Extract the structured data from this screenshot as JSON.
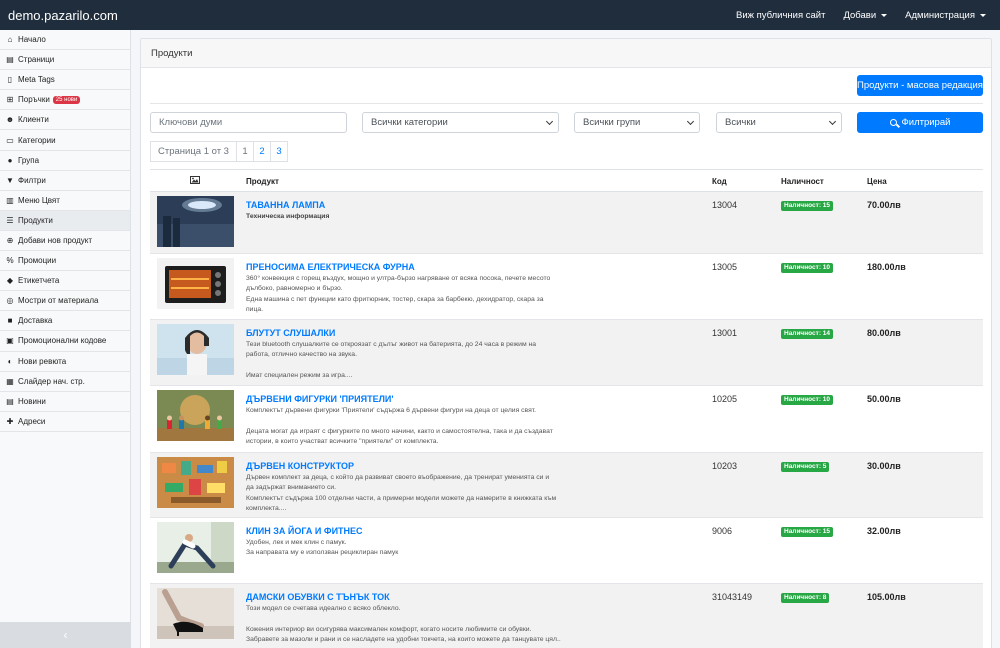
{
  "topbar": {
    "brand": "demo.pazarilo.com",
    "links": [
      {
        "label": "Виж публичния сайт",
        "dropdown": false
      },
      {
        "label": "Добави",
        "dropdown": true
      },
      {
        "label": "Администрация",
        "dropdown": true
      }
    ]
  },
  "sidebar": {
    "items": [
      {
        "label": "Начало",
        "icon": "home-icon",
        "glyph": "⌂"
      },
      {
        "label": "Страници",
        "icon": "page-icon",
        "glyph": "▤"
      },
      {
        "label": "Meta Tags",
        "icon": "file-icon",
        "glyph": "▯"
      },
      {
        "label": "Поръчки",
        "icon": "cart-icon",
        "glyph": "⊞",
        "badge": "25 нови"
      },
      {
        "label": "Клиенти",
        "icon": "users-icon",
        "glyph": "☻"
      },
      {
        "label": "Категории",
        "icon": "folder-icon",
        "glyph": "▭"
      },
      {
        "label": "Група",
        "icon": "group-icon",
        "glyph": "●"
      },
      {
        "label": "Филтри",
        "icon": "filter-icon",
        "glyph": "▼"
      },
      {
        "label": "Меню Цвят",
        "icon": "palette-icon",
        "glyph": "▥"
      },
      {
        "label": "Продукти",
        "icon": "list-icon",
        "glyph": "☰",
        "active": true
      },
      {
        "label": "Добави нов продукт",
        "icon": "plus-circle-icon",
        "glyph": "⊕"
      },
      {
        "label": "Промоции",
        "icon": "percent-icon",
        "glyph": "%"
      },
      {
        "label": "Етикетчета",
        "icon": "tag-icon",
        "glyph": "◆"
      },
      {
        "label": "Мостри от материала",
        "icon": "sample-icon",
        "glyph": "◎"
      },
      {
        "label": "Доставка",
        "icon": "truck-icon",
        "glyph": "■"
      },
      {
        "label": "Промоционални кодове",
        "icon": "ticket-icon",
        "glyph": "▣"
      },
      {
        "label": "Нови ревюта",
        "icon": "comments-icon",
        "glyph": "◐"
      },
      {
        "label": "Слайдер нач. стр.",
        "icon": "slider-icon",
        "glyph": "▦"
      },
      {
        "label": "Новини",
        "icon": "news-icon",
        "glyph": "▤"
      },
      {
        "label": "Адреси",
        "icon": "location-icon",
        "glyph": "✚"
      }
    ],
    "collapse_glyph": "‹"
  },
  "main": {
    "title": "Продукти",
    "bulk_edit_label": "Продукти - масова редакция",
    "keyword_placeholder": "Ключови думи",
    "category_select": "Всички категории",
    "group_select": "Всички групи",
    "status_select": "Всички",
    "filter_label": "Филтрирай",
    "pagination": {
      "info": "Страница 1 от 3",
      "pages": [
        "1",
        "2",
        "3"
      ],
      "current": "1"
    },
    "columns": {
      "image": "image-icon",
      "product": "Продукт",
      "code": "Код",
      "stock": "Наличност",
      "price": "Цена"
    }
  },
  "products": [
    {
      "name": "ТАВАННА ЛАМПА",
      "desc": [
        "Техническа информация"
      ],
      "desc_bold": true,
      "code": "13004",
      "stock": "Наличност: 15",
      "price": "70.00лв",
      "image": "ceiling-lamp-image"
    },
    {
      "name": "ПРЕНОСИМА ЕЛЕКТРИЧЕСКА ФУРНА",
      "desc": [
        "360° конвекция с горещ въздух, мощно и ултра-бързо нагряване от всяка посока, печете месото",
        "дълбоко, равномерно и бързо.",
        "Една машина с пет функции като фритюрник, тостер, скара за барбекю, дехидратор, скара за",
        "пица."
      ],
      "code": "13005",
      "stock": "Наличност: 10",
      "price": "180.00лв",
      "image": "electric-oven-image"
    },
    {
      "name": "БЛУТУТ СЛУШАЛКИ",
      "desc": [
        "Тези bluetooth слушалките се откроязат с дълъг живот на батерията, до 24 часа в режим на",
        "работа, отлично качество на звука.",
        "",
        "Имат специален режим за игра...."
      ],
      "code": "13001",
      "stock": "Наличност: 14",
      "price": "80.00лв",
      "image": "bluetooth-headphones-image"
    },
    {
      "name": "ДЪРВЕНИ ФИГУРКИ 'ПРИЯТЕЛИ'",
      "desc": [
        "Комплектът дървени фигурки 'Приятели' съдържа 6 дървени фигури на деца от целия свят.",
        "",
        "Децата могат да играят с фигурките по много начини, както и самостоятелна, така и да създават",
        "истории, в които участват всичките \"приятели\" от комплекта."
      ],
      "code": "10205",
      "stock": "Наличност: 10",
      "price": "50.00лв",
      "image": "wooden-figures-image"
    },
    {
      "name": "ДЪРВЕН КОНСТРУКТОР",
      "desc": [
        "Дървен комплект за деца, с който да развиват своето въображение, да тренират уменията си и",
        "да задържат вниманието си.",
        "Комплектът съдържа 100 отделни части, а примерни модели можете да намерите в книжката към",
        "комплекта...."
      ],
      "code": "10203",
      "stock": "Наличност: 5",
      "price": "30.00лв",
      "image": "wooden-constructor-image"
    },
    {
      "name": "КЛИН ЗА ЙОГА И ФИТНЕС",
      "desc": [
        "Удобен, лек и мек клин с памук.",
        "За направата му е използван рециклиран памук"
      ],
      "code": "9006",
      "stock": "Наличност: 15",
      "price": "32.00лв",
      "image": "yoga-leggings-image"
    },
    {
      "name": "ДАМСКИ ОБУВКИ С ТЪНЪК ТОК",
      "desc": [
        "Този модел се счетава идеално с всяко облекло.",
        "",
        "Кожения интериор ви осигурява максимален комфорт, когато носите любимите си обувки.",
        "Забравете за мазоли и рани и се насладете на удобни токчета, на които можете да танцувате цял..."
      ],
      "code": "31043149",
      "stock": "Наличност: 8",
      "price": "105.00лв",
      "image": "high-heels-image"
    }
  ]
}
